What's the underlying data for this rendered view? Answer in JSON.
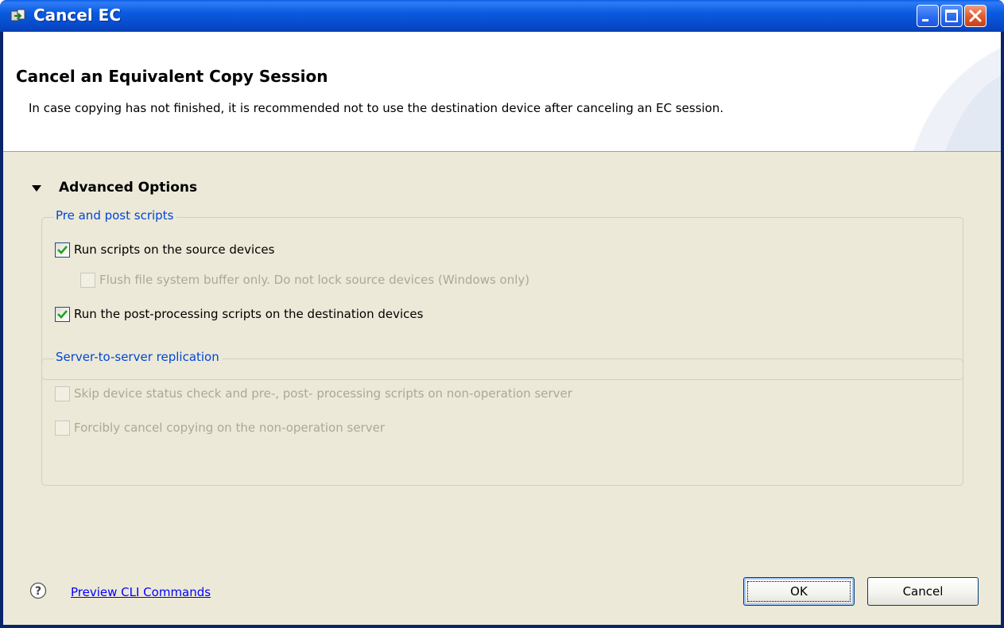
{
  "window": {
    "title": "Cancel EC",
    "app_icon": "ec-app-icon",
    "controls": [
      "minimize-icon",
      "maximize-icon",
      "close-icon"
    ]
  },
  "banner": {
    "title": "Cancel an Equivalent Copy Session",
    "description": "In case copying has not finished, it is recommended not to use the destination device after canceling an EC session."
  },
  "advanced": {
    "label": "Advanced Options",
    "expanded": true
  },
  "pre_post": {
    "legend": "Pre and post scripts",
    "options": [
      {
        "label": "Run scripts on the source devices",
        "checked": true,
        "enabled": true
      },
      {
        "label": "Flush file system buffer only. Do not lock source devices (Windows only)",
        "checked": false,
        "enabled": false
      },
      {
        "label": "Run the post-processing scripts on the destination devices",
        "checked": true,
        "enabled": true
      }
    ]
  },
  "replication": {
    "legend": "Server-to-server replication",
    "options": [
      {
        "label": "Skip device status check and pre-, post- processing scripts on non-operation server",
        "checked": false,
        "enabled": false
      },
      {
        "label": "Forcibly cancel copying on the non-operation server",
        "checked": false,
        "enabled": false
      }
    ]
  },
  "footer": {
    "help_icon": "help-icon",
    "preview_link": "Preview CLI Commands",
    "ok_label": "OK",
    "cancel_label": "Cancel"
  },
  "colors": {
    "title_bar": "#0A5BE0",
    "dialog_bg": "#ECE9D8",
    "group_legend": "#0046D5",
    "disabled_text": "#ACA899",
    "check_mark": "#21A121",
    "link": "#0000FF"
  }
}
